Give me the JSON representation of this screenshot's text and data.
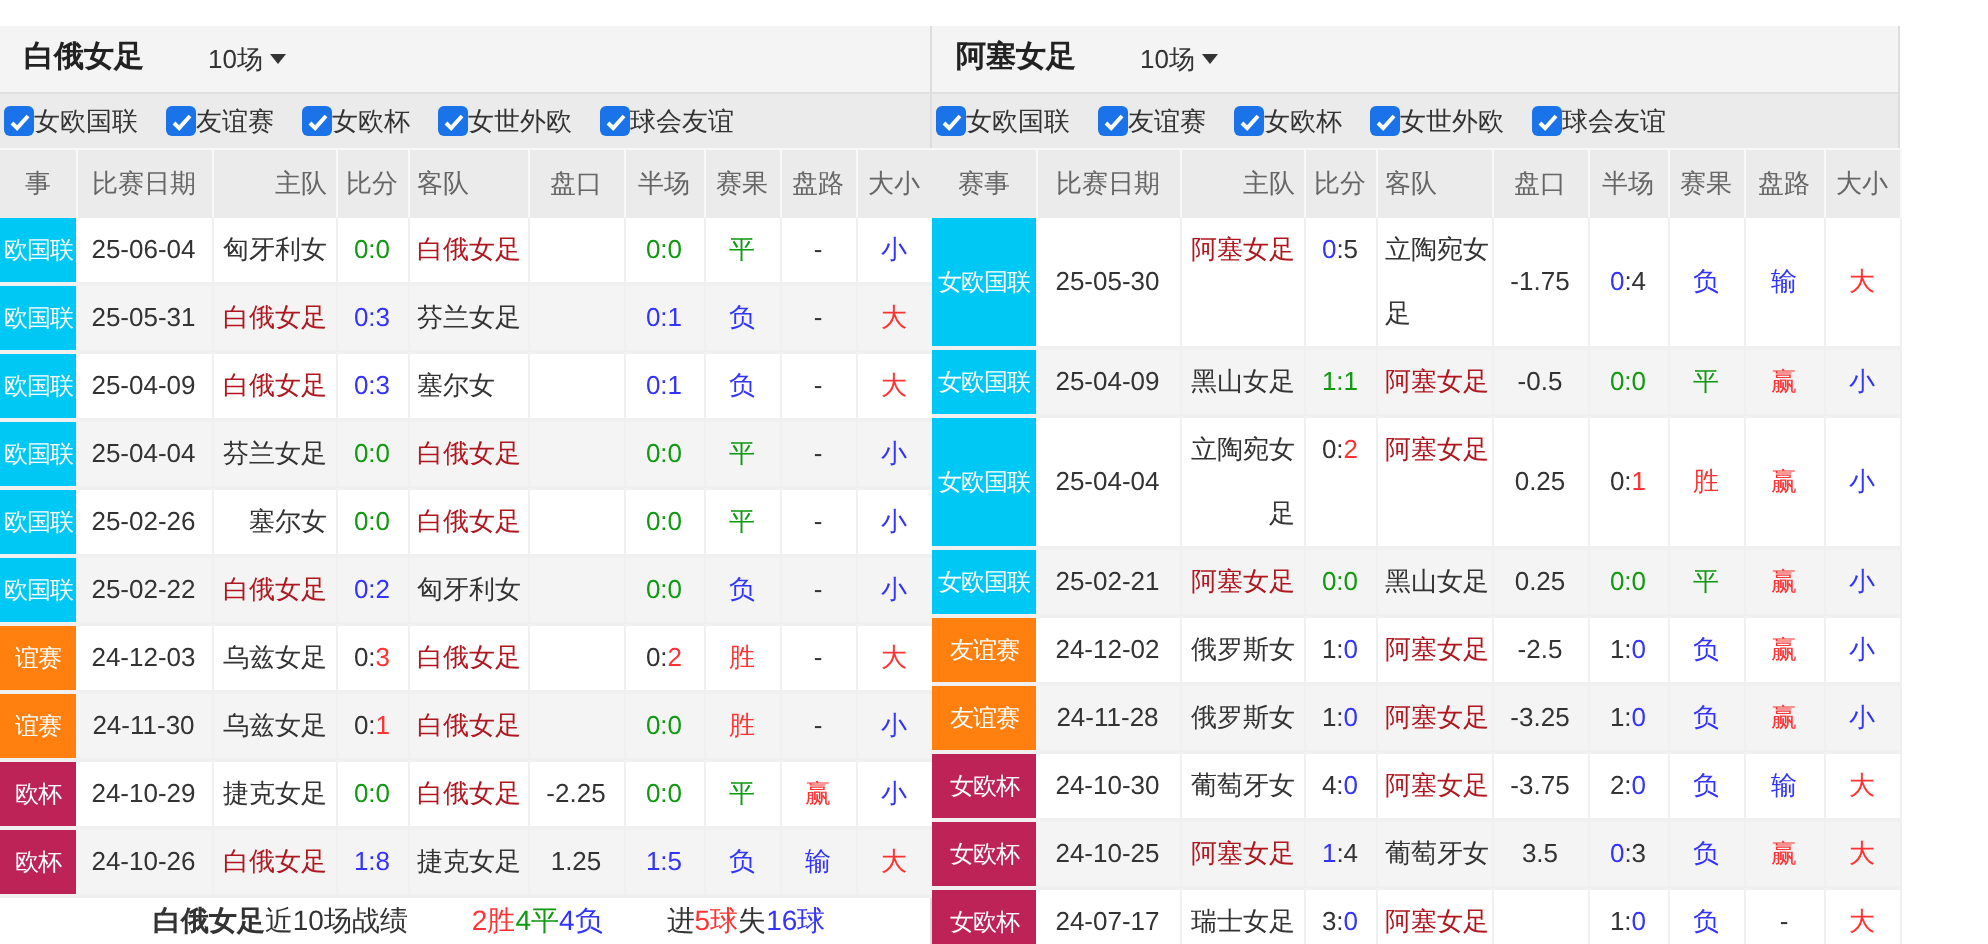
{
  "panels": [
    {
      "team": "白俄女足",
      "games": "10场",
      "filters": [
        {
          "label": "女欧国联",
          "checked": true
        },
        {
          "label": "友谊赛",
          "checked": true
        },
        {
          "label": "女欧杯",
          "checked": true
        },
        {
          "label": "女世外欧",
          "checked": true
        },
        {
          "label": "球会友谊",
          "checked": true
        }
      ],
      "columns": [
        "事",
        "比赛日期",
        "主队",
        "比分",
        "客队",
        "盘口",
        "半场",
        "赛果",
        "盘路",
        "大小"
      ],
      "rows": [
        {
          "competition": "欧国联",
          "color": "#00c8f5",
          "date": "25-06-04",
          "home": {
            "text": "匈牙利女",
            "color": "#333333"
          },
          "score": [
            {
              "text": "0:0",
              "color": "#119911"
            }
          ],
          "away": {
            "text": "白俄女足",
            "color": "#b0161e"
          },
          "half": [
            {
              "text": "0:0",
              "color": "#119911"
            }
          ],
          "result": {
            "text": "平",
            "color": "#119911"
          },
          "trend": {
            "text": "-",
            "color": "#333333"
          },
          "ou": {
            "text": "小",
            "color": "#3333ff"
          }
        },
        {
          "competition": "欧国联",
          "color": "#00c8f5",
          "date": "25-05-31",
          "home": {
            "text": "白俄女足",
            "color": "#b0161e"
          },
          "score": [
            {
              "text": "0:3",
              "color": "#3333ff"
            }
          ],
          "away": {
            "text": "芬兰女足",
            "color": "#333333"
          },
          "half": [
            {
              "text": "0:1",
              "color": "#3333ff"
            }
          ],
          "result": {
            "text": "负",
            "color": "#3333ff"
          },
          "trend": {
            "text": "-",
            "color": "#333333"
          },
          "ou": {
            "text": "大",
            "color": "#ff3333"
          }
        },
        {
          "competition": "欧国联",
          "color": "#00c8f5",
          "date": "25-04-09",
          "home": {
            "text": "白俄女足",
            "color": "#b0161e"
          },
          "score": [
            {
              "text": "0:3",
              "color": "#3333ff"
            }
          ],
          "away": {
            "text": "塞尔女",
            "color": "#333333"
          },
          "half": [
            {
              "text": "0:1",
              "color": "#3333ff"
            }
          ],
          "result": {
            "text": "负",
            "color": "#3333ff"
          },
          "trend": {
            "text": "-",
            "color": "#333333"
          },
          "ou": {
            "text": "大",
            "color": "#ff3333"
          }
        },
        {
          "competition": "欧国联",
          "color": "#00c8f5",
          "date": "25-04-04",
          "home": {
            "text": "芬兰女足",
            "color": "#333333"
          },
          "score": [
            {
              "text": "0:0",
              "color": "#119911"
            }
          ],
          "away": {
            "text": "白俄女足",
            "color": "#b0161e"
          },
          "half": [
            {
              "text": "0:0",
              "color": "#119911"
            }
          ],
          "result": {
            "text": "平",
            "color": "#119911"
          },
          "trend": {
            "text": "-",
            "color": "#333333"
          },
          "ou": {
            "text": "小",
            "color": "#3333ff"
          }
        },
        {
          "competition": "欧国联",
          "color": "#00c8f5",
          "date": "25-02-26",
          "home": {
            "text": "塞尔女",
            "color": "#333333"
          },
          "score": [
            {
              "text": "0:0",
              "color": "#119911"
            }
          ],
          "away": {
            "text": "白俄女足",
            "color": "#b0161e"
          },
          "half": [
            {
              "text": "0:0",
              "color": "#119911"
            }
          ],
          "result": {
            "text": "平",
            "color": "#119911"
          },
          "trend": {
            "text": "-",
            "color": "#333333"
          },
          "ou": {
            "text": "小",
            "color": "#3333ff"
          }
        },
        {
          "competition": "欧国联",
          "color": "#00c8f5",
          "date": "25-02-22",
          "home": {
            "text": "白俄女足",
            "color": "#b0161e"
          },
          "score": [
            {
              "text": "0:2",
              "color": "#3333ff"
            }
          ],
          "away": {
            "text": "匈牙利女",
            "color": "#333333"
          },
          "half": [
            {
              "text": "0:0",
              "color": "#119911"
            }
          ],
          "result": {
            "text": "负",
            "color": "#3333ff"
          },
          "trend": {
            "text": "-",
            "color": "#333333"
          },
          "ou": {
            "text": "小",
            "color": "#3333ff"
          }
        },
        {
          "competition": "谊赛",
          "color": "#ff7f0f",
          "date": "24-12-03",
          "home": {
            "text": "乌兹女足",
            "color": "#333333"
          },
          "score": [
            {
              "text": "0:",
              "color": "#333333"
            },
            {
              "text": "3",
              "color": "#ff3333"
            }
          ],
          "away": {
            "text": "白俄女足",
            "color": "#b0161e"
          },
          "half": [
            {
              "text": "0:",
              "color": "#333333"
            },
            {
              "text": "2",
              "color": "#ff3333"
            }
          ],
          "result": {
            "text": "胜",
            "color": "#ff3333"
          },
          "trend": {
            "text": "-",
            "color": "#333333"
          },
          "ou": {
            "text": "大",
            "color": "#ff3333"
          }
        },
        {
          "competition": "谊赛",
          "color": "#ff7f0f",
          "date": "24-11-30",
          "home": {
            "text": "乌兹女足",
            "color": "#333333"
          },
          "score": [
            {
              "text": "0:",
              "color": "#333333"
            },
            {
              "text": "1",
              "color": "#ff3333"
            }
          ],
          "away": {
            "text": "白俄女足",
            "color": "#b0161e"
          },
          "half": [
            {
              "text": "0:0",
              "color": "#119911"
            }
          ],
          "result": {
            "text": "胜",
            "color": "#ff3333"
          },
          "trend": {
            "text": "-",
            "color": "#333333"
          },
          "ou": {
            "text": "小",
            "color": "#3333ff"
          }
        },
        {
          "competition": "欧杯",
          "color": "#bd2357",
          "date": "24-10-29",
          "home": {
            "text": "捷克女足",
            "color": "#333333"
          },
          "score": [
            {
              "text": "0:0",
              "color": "#119911"
            }
          ],
          "away": {
            "text": "白俄女足",
            "color": "#b0161e"
          },
          "handicap": "-2.25",
          "half": [
            {
              "text": "0:0",
              "color": "#119911"
            }
          ],
          "result": {
            "text": "平",
            "color": "#119911"
          },
          "trend": {
            "text": "赢",
            "color": "#ff3333"
          },
          "ou": {
            "text": "小",
            "color": "#3333ff"
          }
        },
        {
          "competition": "欧杯",
          "color": "#bd2357",
          "date": "24-10-26",
          "home": {
            "text": "白俄女足",
            "color": "#b0161e"
          },
          "score": [
            {
              "text": "1:8",
              "color": "#3333ff"
            }
          ],
          "away": {
            "text": "捷克女足",
            "color": "#333333"
          },
          "handicap": "1.25",
          "half": [
            {
              "text": "1:5",
              "color": "#3333ff"
            }
          ],
          "result": {
            "text": "负",
            "color": "#3333ff"
          },
          "trend": {
            "text": "输",
            "color": "#3333ff"
          },
          "ou": {
            "text": "大",
            "color": "#ff3333"
          }
        }
      ],
      "summary": {
        "title": "**白俄女足**近10场战绩",
        "record": [
          {
            "text": "2胜",
            "color": "#ff3333"
          },
          {
            "text": "4平",
            "color": "#119911"
          },
          {
            "text": "4负",
            "color": "#3333ff"
          }
        ],
        "goals": [
          {
            "text": "进",
            "color": "#333333"
          },
          {
            "text": "5球",
            "color": "#ff3333"
          },
          {
            "text": "失",
            "color": "#333333"
          },
          {
            "text": "16球",
            "color": "#3333ff"
          }
        ]
      }
    },
    {
      "team": "阿塞女足",
      "games": "10场",
      "filters": [
        {
          "label": "女欧国联",
          "checked": true
        },
        {
          "label": "友谊赛",
          "checked": true
        },
        {
          "label": "女欧杯",
          "checked": true
        },
        {
          "label": "女世外欧",
          "checked": true
        },
        {
          "label": "球会友谊",
          "checked": true
        }
      ],
      "columns": [
        "赛事",
        "比赛日期",
        "主队",
        "比分",
        "客队",
        "盘口",
        "半场",
        "赛果",
        "盘路",
        "大小"
      ],
      "rows": [
        {
          "competition": "女欧国联",
          "color": "#00c8f5",
          "date": "25-05-30",
          "home": {
            "text": "阿塞女足",
            "color": "#b0161e"
          },
          "score": [
            {
              "text": "0",
              "color": "#3333ff"
            },
            {
              "text": ":5",
              "color": "#333333"
            }
          ],
          "away": {
            "text": "立陶宛女足",
            "color": "#333333"
          },
          "handicap": "-1.75",
          "half": [
            {
              "text": "0",
              "color": "#3333ff"
            },
            {
              "text": ":4",
              "color": "#333333"
            }
          ],
          "result": {
            "text": "负",
            "color": "#3333ff"
          },
          "trend": {
            "text": "输",
            "color": "#3333ff"
          },
          "ou": {
            "text": "大",
            "color": "#ff3333"
          }
        },
        {
          "competition": "女欧国联",
          "color": "#00c8f5",
          "date": "25-04-09",
          "home": {
            "text": "黑山女足",
            "color": "#333333"
          },
          "score": [
            {
              "text": "1:1",
              "color": "#119911"
            }
          ],
          "away": {
            "text": "阿塞女足",
            "color": "#b0161e"
          },
          "handicap": "-0.5",
          "half": [
            {
              "text": "0:0",
              "color": "#119911"
            }
          ],
          "result": {
            "text": "平",
            "color": "#119911"
          },
          "trend": {
            "text": "赢",
            "color": "#ff3333"
          },
          "ou": {
            "text": "小",
            "color": "#3333ff"
          }
        },
        {
          "competition": "女欧国联",
          "color": "#00c8f5",
          "date": "25-04-04",
          "home": {
            "text": "立陶宛女足",
            "color": "#333333"
          },
          "score": [
            {
              "text": "0:",
              "color": "#333333"
            },
            {
              "text": "2",
              "color": "#ff3333"
            }
          ],
          "away": {
            "text": "阿塞女足",
            "color": "#b0161e"
          },
          "handicap": "0.25",
          "half": [
            {
              "text": "0:",
              "color": "#333333"
            },
            {
              "text": "1",
              "color": "#ff3333"
            }
          ],
          "result": {
            "text": "胜",
            "color": "#ff3333"
          },
          "trend": {
            "text": "赢",
            "color": "#ff3333"
          },
          "ou": {
            "text": "小",
            "color": "#3333ff"
          }
        },
        {
          "competition": "女欧国联",
          "color": "#00c8f5",
          "date": "25-02-21",
          "home": {
            "text": "阿塞女足",
            "color": "#b0161e"
          },
          "score": [
            {
              "text": "0:0",
              "color": "#119911"
            }
          ],
          "away": {
            "text": "黑山女足",
            "color": "#333333"
          },
          "handicap": "0.25",
          "half": [
            {
              "text": "0:0",
              "color": "#119911"
            }
          ],
          "result": {
            "text": "平",
            "color": "#119911"
          },
          "trend": {
            "text": "赢",
            "color": "#ff3333"
          },
          "ou": {
            "text": "小",
            "color": "#3333ff"
          }
        },
        {
          "competition": "友谊赛",
          "color": "#ff7f0f",
          "date": "24-12-02",
          "home": {
            "text": "俄罗斯女",
            "color": "#333333"
          },
          "score": [
            {
              "text": "1:",
              "color": "#333333"
            },
            {
              "text": "0",
              "color": "#3333ff"
            }
          ],
          "away": {
            "text": "阿塞女足",
            "color": "#b0161e"
          },
          "handicap": "-2.5",
          "half": [
            {
              "text": "1:",
              "color": "#333333"
            },
            {
              "text": "0",
              "color": "#3333ff"
            }
          ],
          "result": {
            "text": "负",
            "color": "#3333ff"
          },
          "trend": {
            "text": "赢",
            "color": "#ff3333"
          },
          "ou": {
            "text": "小",
            "color": "#3333ff"
          }
        },
        {
          "competition": "友谊赛",
          "color": "#ff7f0f",
          "date": "24-11-28",
          "home": {
            "text": "俄罗斯女",
            "color": "#333333"
          },
          "score": [
            {
              "text": "1:",
              "color": "#333333"
            },
            {
              "text": "0",
              "color": "#3333ff"
            }
          ],
          "away": {
            "text": "阿塞女足",
            "color": "#b0161e"
          },
          "handicap": "-3.25",
          "half": [
            {
              "text": "1:",
              "color": "#333333"
            },
            {
              "text": "0",
              "color": "#3333ff"
            }
          ],
          "result": {
            "text": "负",
            "color": "#3333ff"
          },
          "trend": {
            "text": "赢",
            "color": "#ff3333"
          },
          "ou": {
            "text": "小",
            "color": "#3333ff"
          }
        },
        {
          "competition": "女欧杯",
          "color": "#bd2357",
          "date": "24-10-30",
          "home": {
            "text": "葡萄牙女",
            "color": "#333333"
          },
          "score": [
            {
              "text": "4:",
              "color": "#333333"
            },
            {
              "text": "0",
              "color": "#3333ff"
            }
          ],
          "away": {
            "text": "阿塞女足",
            "color": "#b0161e"
          },
          "handicap": "-3.75",
          "half": [
            {
              "text": "2:",
              "color": "#333333"
            },
            {
              "text": "0",
              "color": "#3333ff"
            }
          ],
          "result": {
            "text": "负",
            "color": "#3333ff"
          },
          "trend": {
            "text": "输",
            "color": "#3333ff"
          },
          "ou": {
            "text": "大",
            "color": "#ff3333"
          }
        },
        {
          "competition": "女欧杯",
          "color": "#bd2357",
          "date": "24-10-25",
          "home": {
            "text": "阿塞女足",
            "color": "#b0161e"
          },
          "score": [
            {
              "text": "1",
              "color": "#3333ff"
            },
            {
              "text": ":4",
              "color": "#333333"
            }
          ],
          "away": {
            "text": "葡萄牙女",
            "color": "#333333"
          },
          "handicap": "3.5",
          "half": [
            {
              "text": "0",
              "color": "#3333ff"
            },
            {
              "text": ":3",
              "color": "#333333"
            }
          ],
          "result": {
            "text": "负",
            "color": "#3333ff"
          },
          "trend": {
            "text": "赢",
            "color": "#ff3333"
          },
          "ou": {
            "text": "大",
            "color": "#ff3333"
          }
        },
        {
          "competition": "女欧杯",
          "color": "#bd2357",
          "date": "24-07-17",
          "home": {
            "text": "瑞士女足",
            "color": "#333333"
          },
          "score": [
            {
              "text": "3:",
              "color": "#333333"
            },
            {
              "text": "0",
              "color": "#3333ff"
            }
          ],
          "away": {
            "text": "阿塞女足",
            "color": "#b0161e"
          },
          "half": [
            {
              "text": "1:",
              "color": "#333333"
            },
            {
              "text": "0",
              "color": "#3333ff"
            }
          ],
          "result": {
            "text": "负",
            "color": "#3333ff"
          },
          "trend": {
            "text": "-",
            "color": "#333333"
          },
          "ou": {
            "text": "大",
            "color": "#ff3333"
          }
        }
      ]
    }
  ]
}
